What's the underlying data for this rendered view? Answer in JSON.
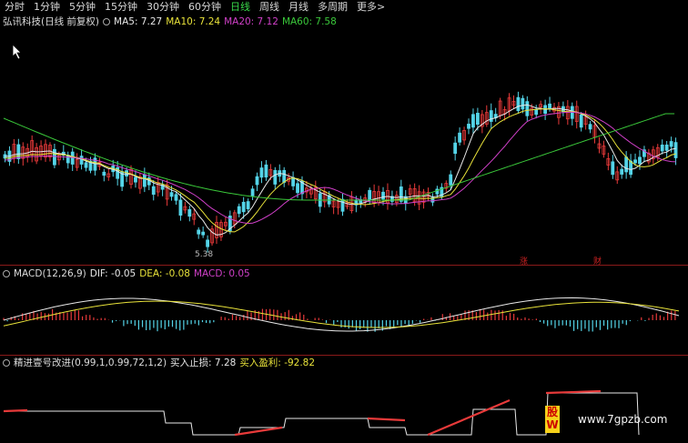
{
  "toolbar": {
    "tabs": [
      "分时",
      "1分钟",
      "5分钟",
      "15分钟",
      "30分钟",
      "60分钟",
      "日线",
      "周线",
      "月线",
      "多周期",
      "更多"
    ],
    "active": "日线",
    "more_arrow": ">"
  },
  "price_panel": {
    "stock_name": "弘讯科技(日线 前复权)",
    "ma5": "MA5: 7.27",
    "ma10": "MA10: 7.24",
    "ma20": "MA20: 7.12",
    "ma60": "MA60: 7.58",
    "low_label": "5.38",
    "marker_zhang": "涨",
    "marker_cai": "财"
  },
  "macd_panel": {
    "title": "MACD(12,26,9)",
    "dif": "DIF: -0.05",
    "dea": "DEA: -0.08",
    "macd": "MACD: 0.05"
  },
  "signal_panel": {
    "title": "精进壹号改进(0.99,1,0.99,72,1,2)",
    "stop": "买入止损: 7.28",
    "profit": "买入盈利: -92.82"
  },
  "watermark": {
    "icon_text": "股W",
    "site": "www.7gpzb.com"
  },
  "colors": {
    "up": "#e83a3a",
    "down": "#54d4e8",
    "ma5": "#e8e8e8",
    "ma10": "#e8e23a",
    "ma20": "#d040c8",
    "ma60": "#3ac83a",
    "separator": "#8b1a1a"
  },
  "icons": [
    "cursor-arrow-icon",
    "ring-icon"
  ]
}
